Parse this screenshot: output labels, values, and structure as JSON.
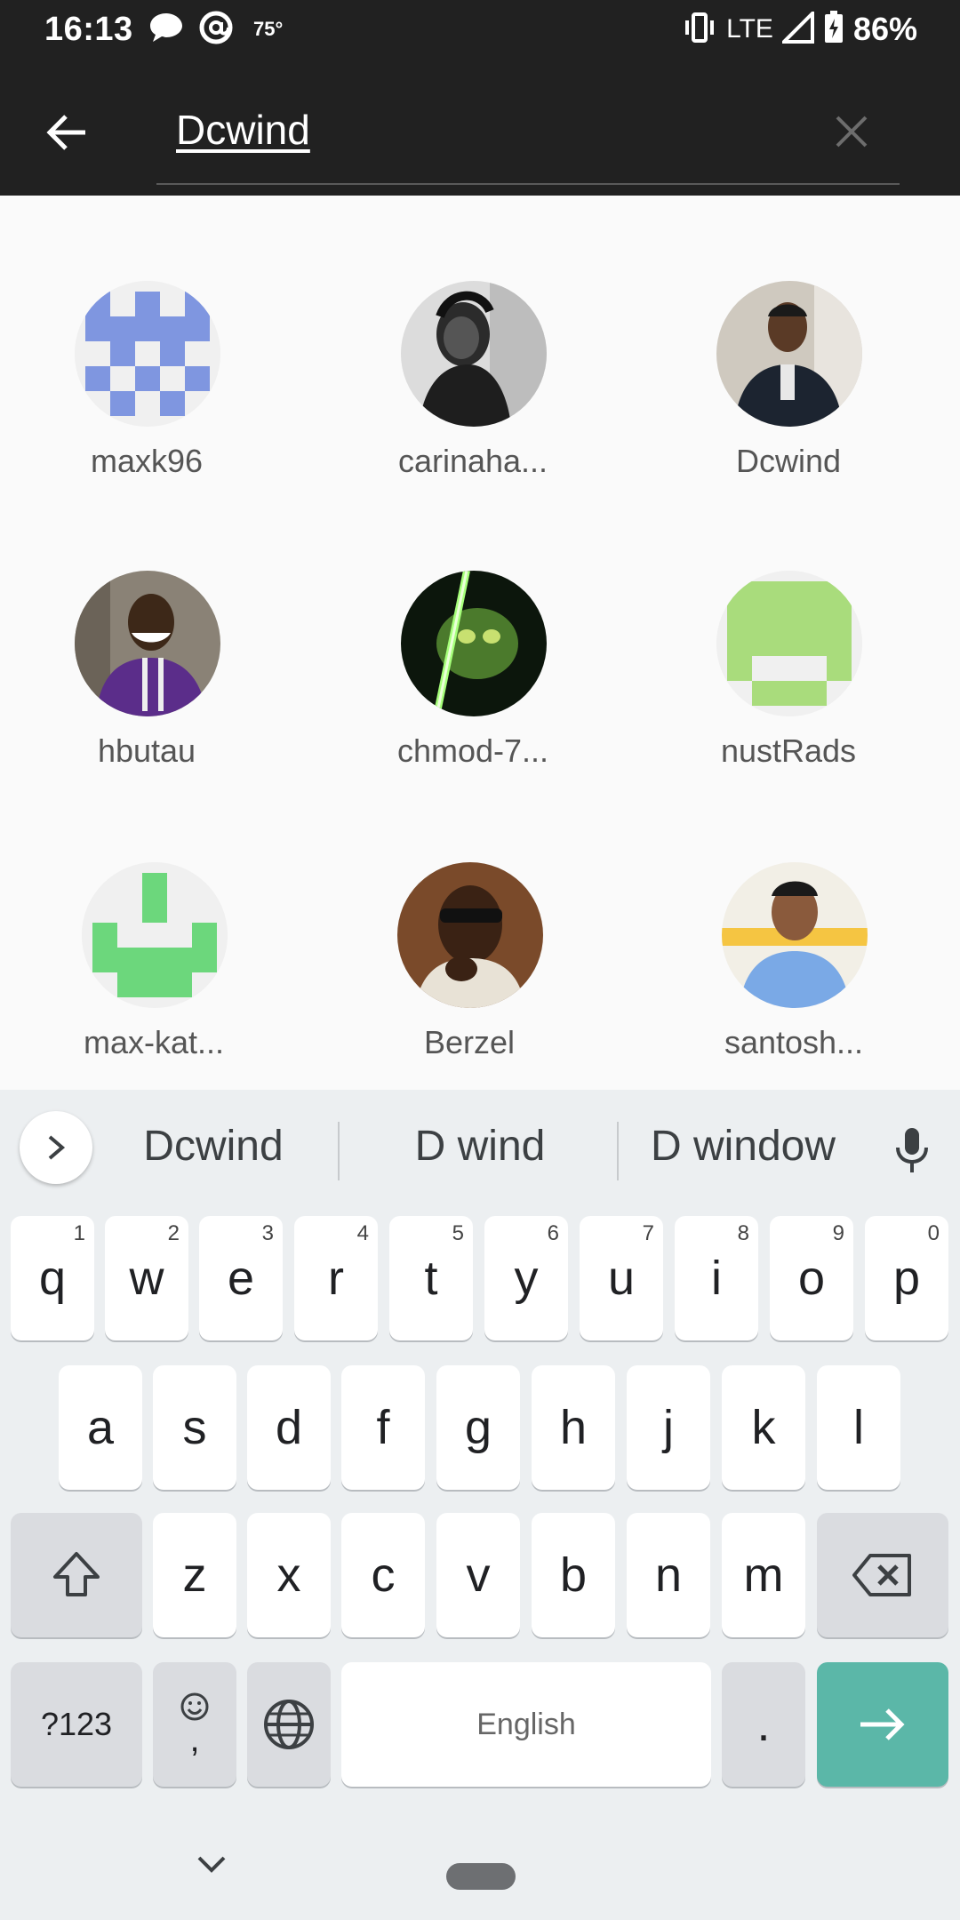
{
  "status_bar": {
    "time": "16:13",
    "temperature": "75°",
    "network": "LTE",
    "battery": "86%"
  },
  "search": {
    "query": "Dcwind",
    "back_icon": "arrow-left-icon",
    "clear_icon": "close-icon"
  },
  "results": [
    {
      "name": "maxk96"
    },
    {
      "name": "carinaha..."
    },
    {
      "name": "Dcwind"
    },
    {
      "name": "hbutau"
    },
    {
      "name": "chmod-7..."
    },
    {
      "name": "nustRads"
    },
    {
      "name": "max-kat..."
    },
    {
      "name": "Berzel"
    },
    {
      "name": "santosh..."
    }
  ],
  "keyboard": {
    "suggestions": [
      "Dcwind",
      "D wind",
      "D window"
    ],
    "row1": [
      {
        "key": "q",
        "hint": "1"
      },
      {
        "key": "w",
        "hint": "2"
      },
      {
        "key": "e",
        "hint": "3"
      },
      {
        "key": "r",
        "hint": "4"
      },
      {
        "key": "t",
        "hint": "5"
      },
      {
        "key": "y",
        "hint": "6"
      },
      {
        "key": "u",
        "hint": "7"
      },
      {
        "key": "i",
        "hint": "8"
      },
      {
        "key": "o",
        "hint": "9"
      },
      {
        "key": "p",
        "hint": "0"
      }
    ],
    "row2": [
      "a",
      "s",
      "d",
      "f",
      "g",
      "h",
      "j",
      "k",
      "l"
    ],
    "row3": [
      "z",
      "x",
      "c",
      "v",
      "b",
      "n",
      "m"
    ],
    "symbols_label": "?123",
    "comma_label": ",",
    "space_label": "English",
    "period_label": ".",
    "colors": {
      "action": "#5bb7a8"
    }
  }
}
